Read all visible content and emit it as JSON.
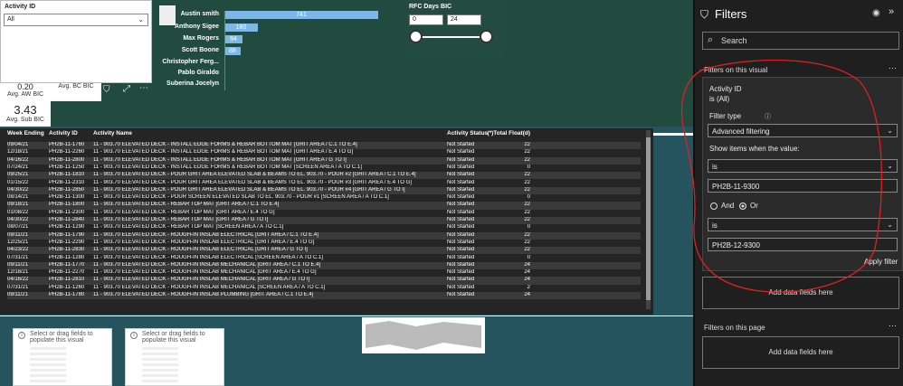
{
  "slicer": {
    "title": "Activity ID",
    "value": "All"
  },
  "kpis": [
    {
      "value": "0.20",
      "label": "Avg. AW BIC"
    },
    {
      "value": "",
      "label": "Avg. BC BIC"
    },
    {
      "value": "3.43",
      "label": "Avg. Sub BIC"
    }
  ],
  "bar_chart": {
    "names": [
      "Austin smith",
      "Anthony Sigee",
      "Max Rogers",
      "Scott Boone",
      "Christopher Ferg...",
      "Pablo Giraldo",
      "Suberina Jocelyn"
    ],
    "values": [
      "741",
      "180",
      "94",
      "88",
      "",
      "",
      ""
    ]
  },
  "rfc": {
    "title": "RFC Days BIC",
    "min": "0",
    "max": "24"
  },
  "table": {
    "headers": [
      "Week Ending",
      "Activity ID",
      "Activity Name",
      "Activity Status",
      "(*)Total Float(d)"
    ],
    "rows": [
      [
        "09/04/21",
        "PH2B-11-1760",
        "11 - 903.70 ELEVATED DECK - INSTALL EDGE FORMS & REBAR BOTTOM MAT [GRIT AREA / C.1 TO E.4]",
        "Not Started",
        "22"
      ],
      [
        "12/18/21",
        "PH2B-11-2260",
        "11 - 903.70 ELEVATED DECK - INSTALL EDGE FORMS & REBAR BOTTOM MAT [GRIT AREA / E.4 TO G]",
        "Not Started",
        "22"
      ],
      [
        "04/16/22",
        "PH2B-11-2800",
        "11 - 903.70 ELEVATED DECK - INSTALL EDGE FORMS & REBAR BOTTOM MAT [GRIT AREA / G TO I]",
        "Not Started",
        "22"
      ],
      [
        "07/24/21",
        "PH2B-11-1250",
        "11 - 903.70 ELEVATED DECK - INSTALL EDGE FORMS & REBAR BOTTOM MAT [SCREEN AREA / A TO C.1]",
        "Not Started",
        "0"
      ],
      [
        "09/25/21",
        "PH2B-11-1810",
        "11 - 903.70 ELEVATED DECK - POUR GRIT AREA ELEVATED SLAB & BEAMS TO EL. 903.70 - POUR #2 [GRIT AREA / C.1 TO E.4]",
        "Not Started",
        "22"
      ],
      [
        "01/15/22",
        "PH2B-11-2310",
        "11 - 903.70 ELEVATED DECK - POUR GRIT AREA ELEVATED SLAB & BEAMS TO EL. 903.70 - POUR #3 [GRIT AREA / E.4 TO G]",
        "Not Started",
        "22"
      ],
      [
        "04/30/22",
        "PH2B-11-2850",
        "11 - 903.70 ELEVATED DECK - POUR GRIT AREA ELEVATED SLAB & BEAMS TO EL. 903.70 - POUR #4 [GRIT AREA / G TO I]",
        "Not Started",
        "22"
      ],
      [
        "08/14/21",
        "PH2B-11-1300",
        "11 - 903.70 ELEVATED DECK - POUR SCREEN ELEVATED SLAB TO EL. 903.70 - POUR #1 [SCREEN AREA / A TO C.1]",
        "Not Started",
        "0"
      ],
      [
        "09/18/21",
        "PH2B-11-1800",
        "11 - 903.70 ELEVATED DECK - REBAR TOP MAT [GRIT AREA / C.1 TO E.4]",
        "Not Started",
        "22"
      ],
      [
        "01/08/22",
        "PH2B-11-2300",
        "11 - 903.70 ELEVATED DECK - REBAR TOP MAT [GRIT AREA / E.4 TO G]",
        "Not Started",
        "22"
      ],
      [
        "04/30/22",
        "PH2B-11-2840",
        "11 - 903.70 ELEVATED DECK - REBAR TOP MAT [GRIT AREA / G TO I]",
        "Not Started",
        "22"
      ],
      [
        "08/07/21",
        "PH2B-11-1290",
        "11 - 903.70 ELEVATED DECK - REBAR TOP MAT [SCREEN AREA / A TO C.1]",
        "Not Started",
        "0"
      ],
      [
        "09/11/21",
        "PH2B-11-1790",
        "11 - 903.70 ELEVATED DECK - ROUGH-IN INSLAB ELECTRICAL [GRIT AREA / C.1 TO E.4]",
        "Not Started",
        "22"
      ],
      [
        "12/25/21",
        "PH2B-11-2290",
        "11 - 903.70 ELEVATED DECK - ROUGH-IN INSLAB ELECTRICAL [GRIT AREA / E.4 TO G]",
        "Not Started",
        "22"
      ],
      [
        "04/23/22",
        "PH2B-11-2830",
        "11 - 903.70 ELEVATED DECK - ROUGH-IN INSLAB ELECTRICAL [GRIT AREA / G TO I]",
        "Not Started",
        "22"
      ],
      [
        "07/31/21",
        "PH2B-11-1280",
        "11 - 903.70 ELEVATED DECK - ROUGH-IN INSLAB ELECTRICAL [SCREEN AREA / A TO C.1]",
        "Not Started",
        "0"
      ],
      [
        "09/11/21",
        "PH2B-11-1770",
        "11 - 903.70 ELEVATED DECK - ROUGH-IN INSLAB MECHANICAL [GRIT AREA / C.1 TO E.4]",
        "Not Started",
        "24"
      ],
      [
        "12/18/21",
        "PH2B-11-2270",
        "11 - 903.70 ELEVATED DECK - ROUGH-IN INSLAB MECHANICAL [GRIT AREA / E.4 TO G]",
        "Not Started",
        "24"
      ],
      [
        "04/16/22",
        "PH2B-11-2810",
        "11 - 903.70 ELEVATED DECK - ROUGH-IN INSLAB MECHANICAL [GRIT AREA / G TO I]",
        "Not Started",
        "24"
      ],
      [
        "07/31/21",
        "PH2B-11-1260",
        "11 - 903.70 ELEVATED DECK - ROUGH-IN INSLAB MECHANICAL [SCREEN AREA / A TO C.1]",
        "Not Started",
        "2"
      ],
      [
        "09/11/21",
        "PH2B-11-1780",
        "11 - 903.70 ELEVATED DECK - ROUGH-IN INSLAB PLUMBING [GRIT AREA / C.1 TO E.4]",
        "Not Started",
        "24"
      ]
    ]
  },
  "placeholders": [
    {
      "text": "Select or drag fields to populate this visual"
    },
    {
      "text": "Select or drag fields to populate this visual"
    }
  ],
  "filters": {
    "title": "Filters",
    "search_placeholder": "Search",
    "on_visual": "Filters on this visual",
    "card": {
      "field": "Activity ID",
      "state": "is (All)",
      "filter_type_label": "Filter type",
      "filter_type_value": "Advanced filtering",
      "show_items_label": "Show items when the value:",
      "op1": "is",
      "value1": "PH2B-11-9300",
      "and_label": "And",
      "or_label": "Or",
      "op2": "is",
      "value2": "PH2B-12-9300",
      "apply_label": "Apply filter"
    },
    "add_data_fields": "Add data fields here",
    "on_page": "Filters on this page",
    "add_data_fields_page": "Add data fields here"
  },
  "colors": {
    "pane_bg": "#1f1f1f",
    "canvas_bg": "#25545e",
    "bar": "#7cb7e8",
    "annotation": "#e02020"
  }
}
